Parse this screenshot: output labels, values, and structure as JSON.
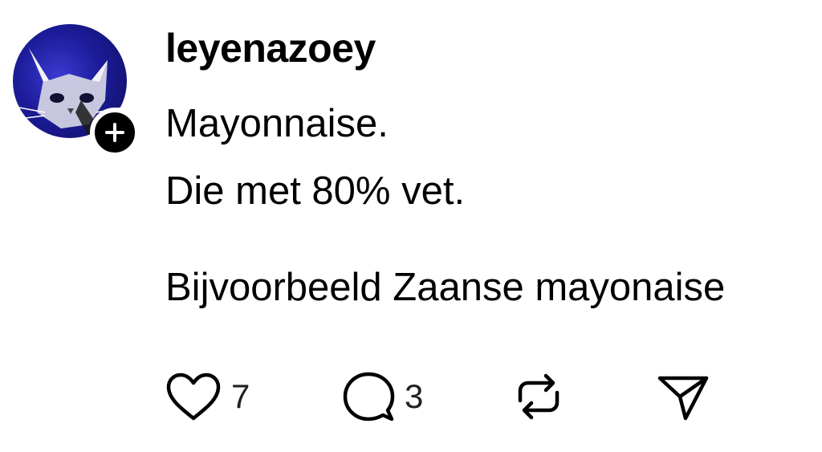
{
  "post": {
    "username": "leyenazoey",
    "lines": [
      "Mayonnaise.",
      "Die met 80% vet.",
      "Bijvoorbeeld Zaanse mayonaise"
    ]
  },
  "actions": {
    "like_count": "7",
    "reply_count": "3"
  },
  "icons": {
    "like": "heart-icon",
    "reply": "speech-bubble-icon",
    "repost": "repost-icon",
    "share": "paper-plane-icon",
    "follow": "plus-icon"
  },
  "colors": {
    "text": "#000000",
    "background": "#ffffff",
    "avatar_accent": "#1c1c9a"
  }
}
